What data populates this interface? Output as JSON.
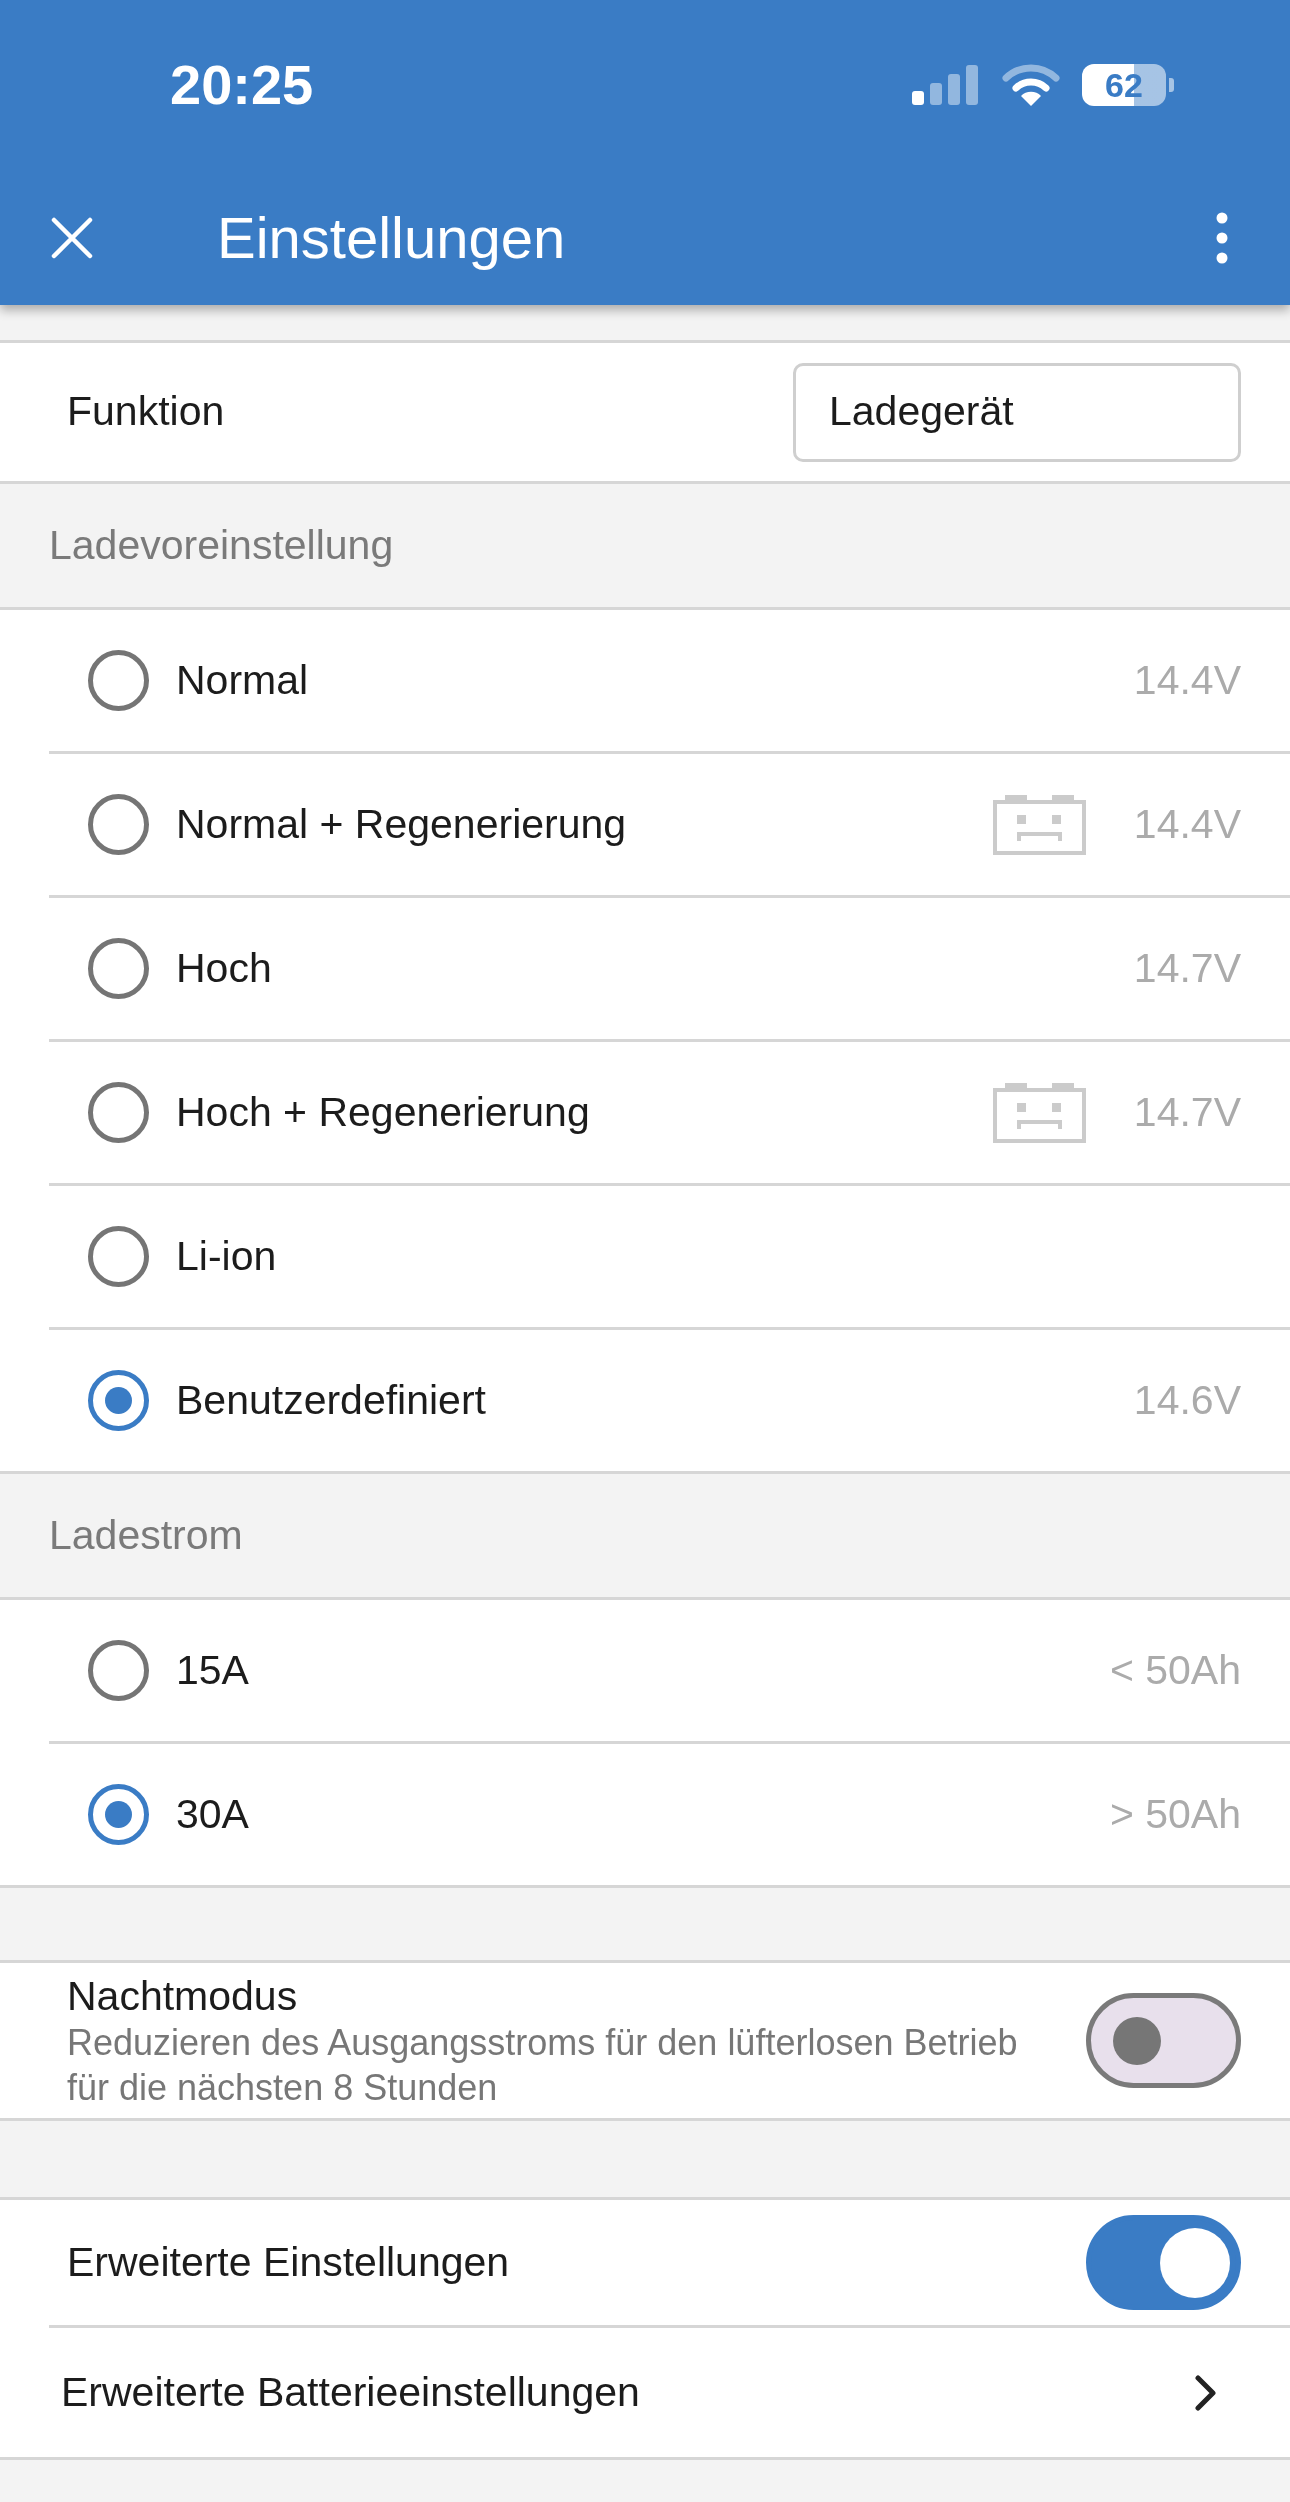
{
  "status_bar": {
    "time": "20:25",
    "battery": "62"
  },
  "app_bar": {
    "title": "Einstellungen"
  },
  "function_row": {
    "label": "Funktion",
    "value": "Ladegerät"
  },
  "sections": [
    {
      "title": "Ladevoreinstellung",
      "options": [
        {
          "label": "Normal",
          "value": "14.4V",
          "selected": false,
          "battery_icon": false
        },
        {
          "label": "Normal + Regenerierung",
          "value": "14.4V",
          "selected": false,
          "battery_icon": true
        },
        {
          "label": "Hoch",
          "value": "14.7V",
          "selected": false,
          "battery_icon": false
        },
        {
          "label": "Hoch + Regenerierung",
          "value": "14.7V",
          "selected": false,
          "battery_icon": true
        },
        {
          "label": "Li-ion",
          "selected": false,
          "battery_icon": false
        },
        {
          "label": "Benutzerdefiniert",
          "value": "14.6V",
          "selected": true,
          "battery_icon": false
        }
      ]
    },
    {
      "title": "Ladestrom",
      "options": [
        {
          "label": "15A",
          "value": "< 50Ah",
          "selected": false,
          "battery_icon": false
        },
        {
          "label": "30A",
          "value": "> 50Ah",
          "selected": true,
          "battery_icon": false
        }
      ]
    }
  ],
  "night_mode": {
    "title": "Nachtmodus",
    "description": "Reduzieren des Ausgangsstroms für den lüfterlosen Betrieb für die nächsten 8 Stunden",
    "on": false
  },
  "advanced_settings": {
    "label": "Erweiterte Einstellungen",
    "on": true
  },
  "battery_settings": {
    "label": "Erweiterte Batterieeinstellungen"
  }
}
